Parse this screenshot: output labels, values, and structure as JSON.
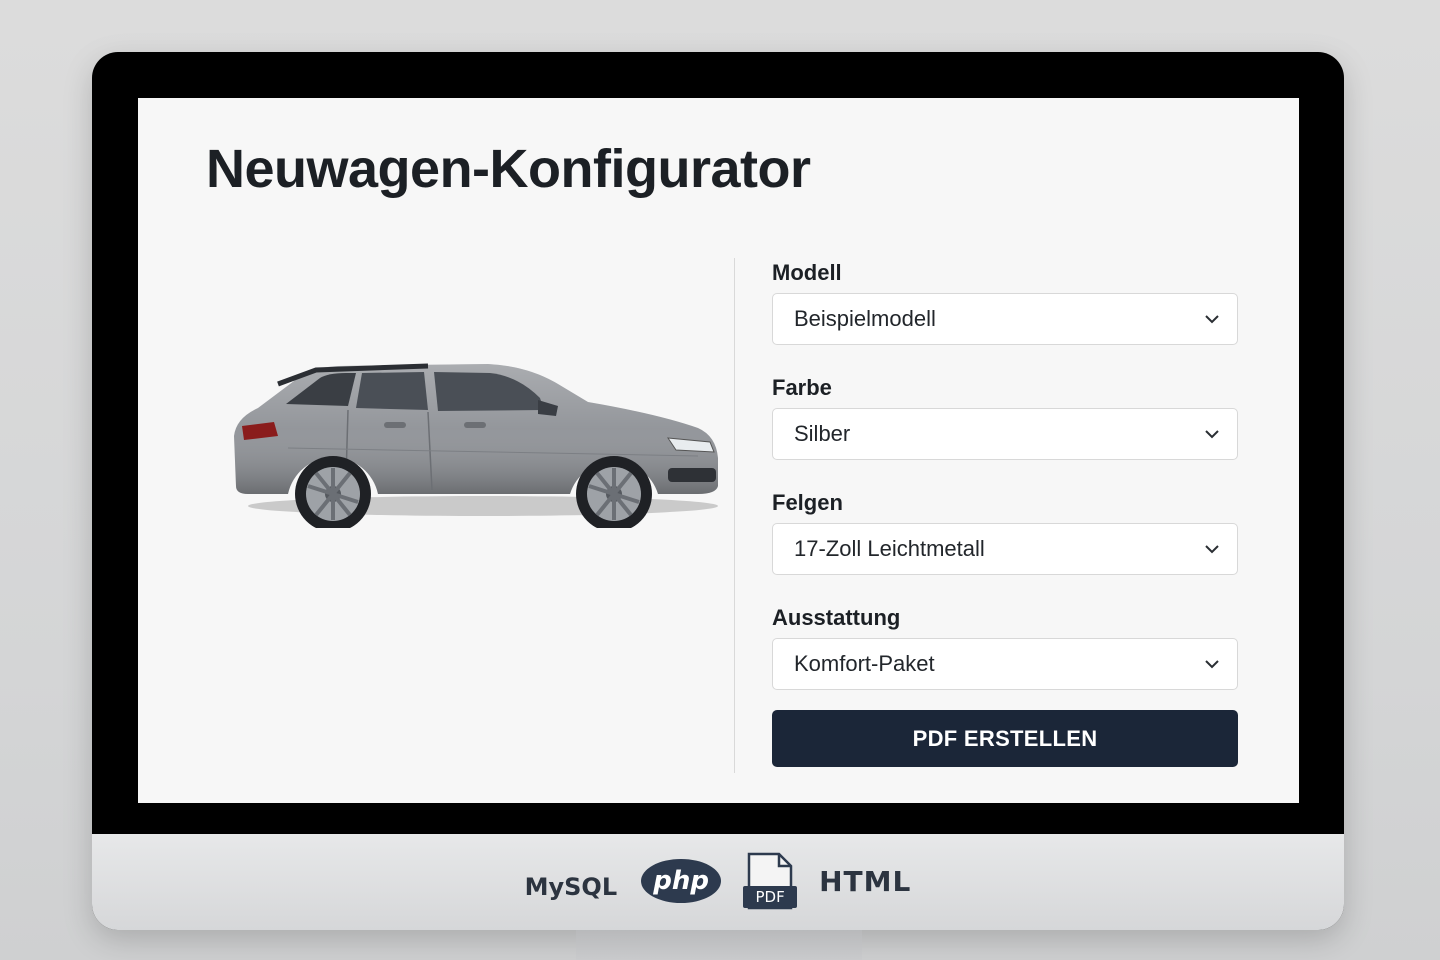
{
  "page": {
    "title": "Neuwagen-Konfigurator"
  },
  "form": {
    "fields": [
      {
        "label": "Modell",
        "value": "Beispielmodell"
      },
      {
        "label": "Farbe",
        "value": "Silber"
      },
      {
        "label": "Felgen",
        "value": "17-Zoll Leichtmetall"
      },
      {
        "label": "Ausstattung",
        "value": "Komfort-Paket"
      }
    ],
    "submit_label": "PDF ERSTELLEN"
  },
  "car": {
    "color": "#8e9196"
  },
  "colors": {
    "button": "#1b2638",
    "title": "#1c2025",
    "monitor_bezel": "#000000"
  },
  "logos": {
    "mysql": "MySQL",
    "php": "php",
    "pdf": "PDF",
    "html": "HTML"
  }
}
